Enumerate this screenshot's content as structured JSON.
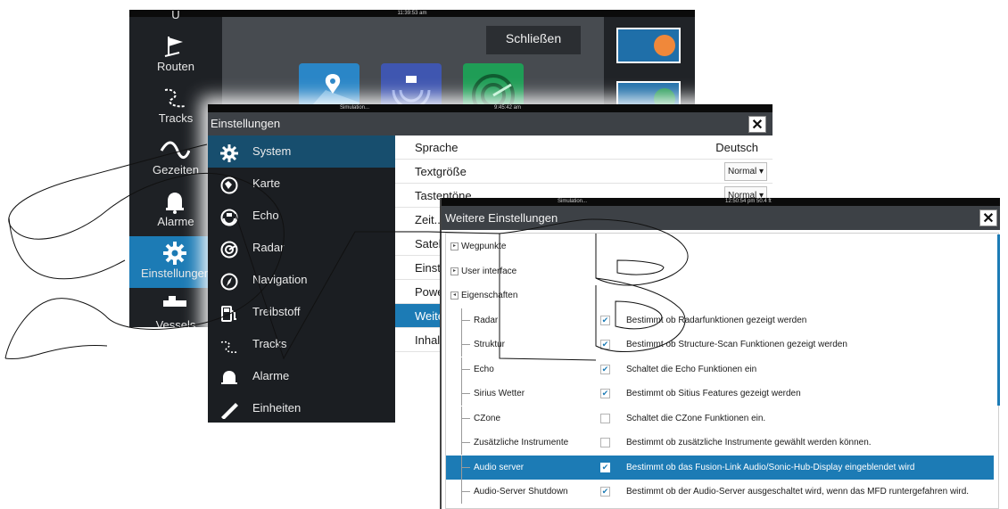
{
  "back_screen": {
    "clock": "11:39:53 am",
    "close_label": "Schließen",
    "nav_partial_label": "U",
    "nav": [
      {
        "label": "Routen",
        "icon": "route-flag-icon"
      },
      {
        "label": "Tracks",
        "icon": "tracks-icon"
      },
      {
        "label": "Gezeiten",
        "icon": "tide-wave-icon"
      },
      {
        "label": "Alarme",
        "icon": "bell-icon"
      },
      {
        "label": "Einstellungen",
        "icon": "gear-icon",
        "selected": true
      },
      {
        "label": "Vessels",
        "icon": "vessels-icon"
      }
    ],
    "app_icons": [
      "chart-app-icon",
      "sonar-app-icon",
      "radar-app-icon"
    ]
  },
  "settings_dialog": {
    "status_left": "Simulation...",
    "clock": "9:45:42 am",
    "title": "Einstellungen",
    "close_glyph": "✕",
    "sidebar": [
      {
        "label": "System",
        "icon": "gear-icon",
        "selected": true
      },
      {
        "label": "Karte",
        "icon": "globe-icon"
      },
      {
        "label": "Echo",
        "icon": "echo-icon"
      },
      {
        "label": "Radar",
        "icon": "radar-icon"
      },
      {
        "label": "Navigation",
        "icon": "compass-icon"
      },
      {
        "label": "Treibstoff",
        "icon": "fuel-pump-icon"
      },
      {
        "label": "Tracks",
        "icon": "tracks-icon"
      },
      {
        "label": "Alarme",
        "icon": "bell-icon"
      },
      {
        "label": "Einheiten",
        "icon": "ruler-icon"
      }
    ],
    "rows": [
      {
        "label": "Sprache",
        "value": "Deutsch"
      },
      {
        "label": "Textgröße",
        "select": "Normal"
      },
      {
        "label": "Tastentöne",
        "select": "Normal"
      },
      {
        "label": "Zeit..."
      },
      {
        "label": "Satel..."
      },
      {
        "label": "Einst..."
      },
      {
        "label": "Powe..."
      },
      {
        "label": "Weite...",
        "selected": true
      },
      {
        "label": "Inhal..."
      }
    ]
  },
  "more_settings_dialog": {
    "status_left": "Simulation...",
    "status_right": "12:50:54 pm   50.4 ft",
    "title": "Weitere Einstellungen",
    "close_glyph": "✕",
    "tree": [
      {
        "label": "Wegpunkte",
        "level": 0,
        "expander": "▸"
      },
      {
        "label": "User interface",
        "level": 0,
        "expander": "▸"
      },
      {
        "label": "Eigenschaften",
        "level": 0,
        "expander": "◂"
      },
      {
        "label": "Radar",
        "level": 1,
        "checked": true,
        "desc": "Bestimmt ob Radarfunktionen gezeigt werden"
      },
      {
        "label": "Struktur",
        "level": 1,
        "checked": true,
        "desc": "Bestimmt ob Structure-Scan Funktionen gezeigt werden"
      },
      {
        "label": "Echo",
        "level": 1,
        "checked": true,
        "desc": "Schaltet die Echo Funktionen ein"
      },
      {
        "label": "Sirius Wetter",
        "level": 1,
        "checked": true,
        "desc": "Bestimmt ob Sitius Features gezeigt werden"
      },
      {
        "label": "CZone",
        "level": 1,
        "checked": false,
        "desc": "Schaltet die CZone Funktionen ein."
      },
      {
        "label": "Zusätzliche Instrumente",
        "level": 1,
        "checked": false,
        "desc": "Bestimmt ob zusätzliche Instrumente gewählt werden können."
      },
      {
        "label": "Audio server",
        "level": 1,
        "checked": true,
        "selected": true,
        "desc": "Bestimmt ob das Fusion-Link Audio/Sonic-Hub-Display eingeblendet wird"
      },
      {
        "label": "Audio-Server Shutdown",
        "level": 1,
        "checked": true,
        "desc": "Bestimmt ob der Audio-Server ausgeschaltet wird, wenn das MFD runtergefahren wird."
      }
    ],
    "check_glyph": "✔"
  },
  "colors": {
    "accent": "#1c7bb5",
    "dark_panel": "#1b1e22",
    "titlebar": "#3d4146"
  }
}
